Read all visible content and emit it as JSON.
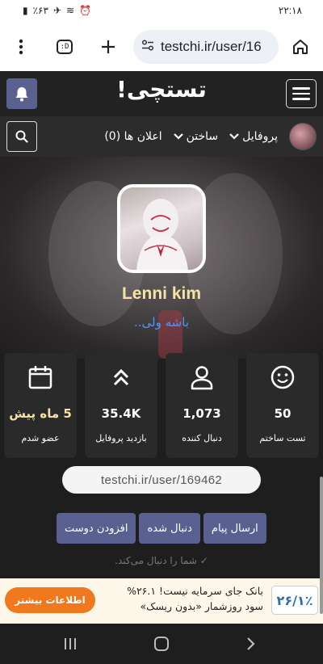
{
  "status_bar": {
    "time": "۲۲:۱۸",
    "battery": "٪۶۳",
    "icons": [
      "battery-icon",
      "airplane-icon",
      "wifi-icon",
      "alarm-icon"
    ]
  },
  "browser": {
    "url": "testchi.ir/user/16",
    "tab_label": ":D",
    "icons": [
      "menu-dots-icon",
      "tab-switcher-icon",
      "plus-icon",
      "site-settings-icon",
      "home-icon"
    ]
  },
  "site_header": {
    "logo": "تستچی!",
    "icons": [
      "bell-icon",
      "hamburger-menu-icon"
    ]
  },
  "nav": {
    "items": [
      {
        "label": "پروفایل"
      },
      {
        "label": "ساختن"
      },
      {
        "label": "اعلان ها (0)"
      }
    ],
    "icons": [
      "search-icon",
      "chevron-down-icon"
    ]
  },
  "profile": {
    "username": "Lenni kim",
    "bio": "باشه ولی..",
    "url": "testchi.ir/user/169462"
  },
  "stats": [
    {
      "icon": "smile-icon",
      "value": "50",
      "label": "تست ساختم"
    },
    {
      "icon": "user-icon",
      "value": "1,073",
      "label": "دنبال کننده"
    },
    {
      "icon": "chevrons-up-icon",
      "value": "35.4K",
      "label": "بازدید پروفایل"
    },
    {
      "icon": "calendar-icon",
      "value": "5 ماه پیش",
      "label": "عضو شدم"
    }
  ],
  "actions": {
    "message": "ارسال پیام",
    "followed": "دنبال شده",
    "add_friend": "افزودن دوست"
  },
  "following_text": "✓ شما را دنبال می‌کند.",
  "ad": {
    "percent": "۲۶/۱٪",
    "line1": "بانک جای سرمایه نیست! ۲۶.۱%",
    "line2": "سود روزشمار «بدون ریسک»",
    "button": "اطلاعات بیشتر"
  },
  "colors": {
    "accent": "#5a6190",
    "gold": "#f3e3a5",
    "link": "#4d96ff",
    "ad_button": "#f0781e"
  }
}
